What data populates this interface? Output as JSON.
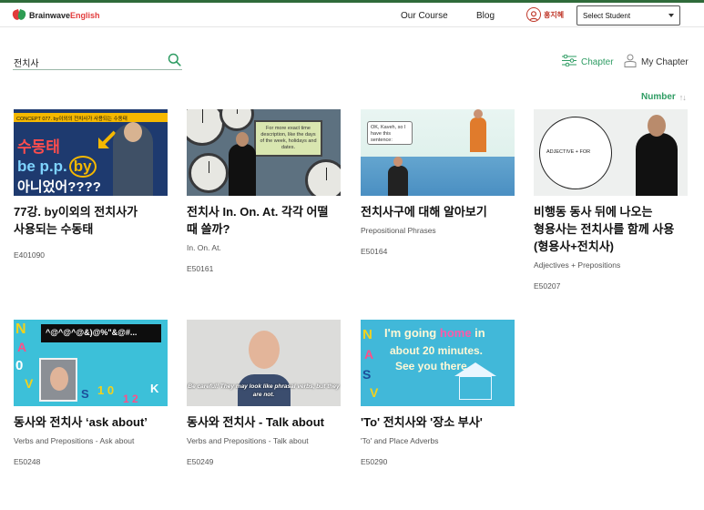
{
  "header": {
    "logo_brand": "Brainwave",
    "logo_accent": "English",
    "nav": [
      {
        "label": "Our Course"
      },
      {
        "label": "Blog"
      }
    ],
    "user_name": "홍지혜",
    "student_select": "Select Student"
  },
  "search": {
    "value": "전치사"
  },
  "filters": {
    "chapter_label": "Chapter",
    "my_chapter_label": "My Chapter"
  },
  "sort": {
    "label": "Number"
  },
  "cards": [
    {
      "title": "77강. by이외의 전치사가 사용되는 수동태",
      "subtitle": "",
      "code": "E401090",
      "thumb_banner": "CONCEPT 077. by이외의 전치사가 사용되는 수동태",
      "thumb_line1": "수동태",
      "thumb_line2": "be p.p.",
      "thumb_line2_circled": "by",
      "thumb_line3": "아니었어????"
    },
    {
      "title": "전치사 In. On. At. 각각 어떨 때 쓸까?",
      "subtitle": "In. On. At.",
      "code": "E50161",
      "thumb_note": "For more exact time description, like the days of the week, holidays and dates."
    },
    {
      "title": "전치사구에 대해 알아보기",
      "subtitle": "Prepositional Phrases",
      "code": "E50164",
      "thumb_bubble": "OK, Kaveh, so I have this sentence:"
    },
    {
      "title": "비행동 동사 뒤에 나오는 형용사는 전치사를 함께 사용(형용사+전치사)",
      "subtitle": "Adjectives + Prepositions",
      "code": "E50207",
      "thumb_circle": "ADJECTIVE + FOR"
    },
    {
      "title": "동사와 전치사 ‘ask about’",
      "subtitle": "Verbs and Prepositions - Ask about",
      "code": "E50248",
      "thumb_strip": "^@^@^@&)@%\"&@#..."
    },
    {
      "title": "동사와 전치사 - Talk about",
      "subtitle": "Verbs and Prepositions - Talk about",
      "code": "E50249",
      "thumb_caption": "Be careful! They may look like phrasal verbs, but they are not."
    },
    {
      "title": "'To' 전치사와 '장소 부사'",
      "subtitle": "'To' and Place Adverbs",
      "code": "E50290",
      "thumb_line1_pre": "I'm going",
      "thumb_line1_em": "home",
      "thumb_line1_post": "in",
      "thumb_line2": "about 20 minutes.",
      "thumb_line3": "See you there."
    }
  ],
  "colors": {
    "brand_green": "#2e9c63",
    "brand_red": "#e23b3b",
    "topline": "#2f6b3a"
  }
}
